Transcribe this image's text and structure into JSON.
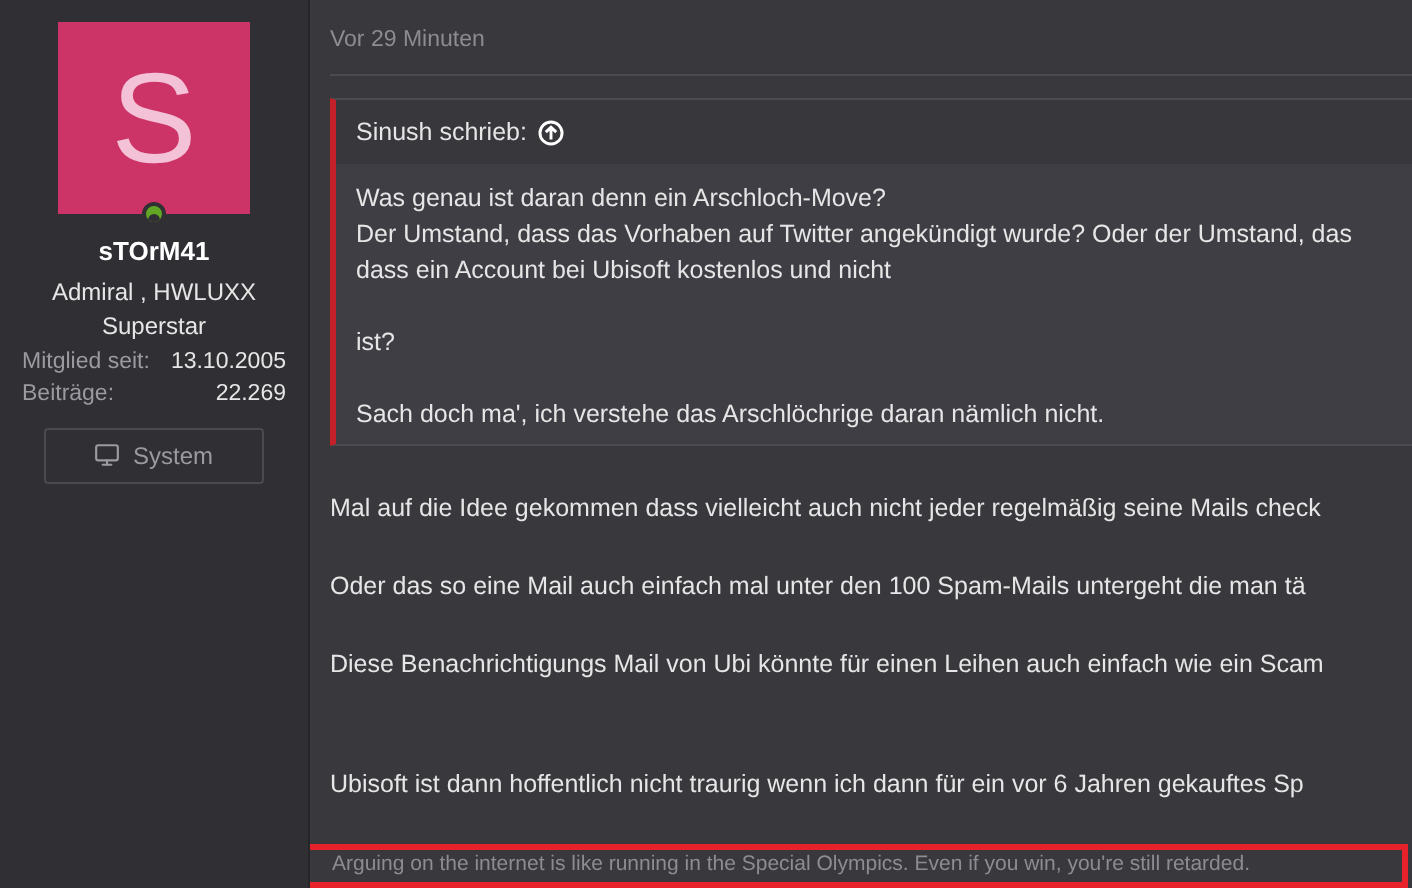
{
  "author": {
    "avatar_letter": "S",
    "online": true,
    "name": "sTOrM41",
    "rank": "Admiral , HWLUXX Superstar",
    "stats": [
      {
        "label": "Mitglied seit:",
        "value": "13.10.2005"
      },
      {
        "label": "Beiträge:",
        "value": "22.269"
      }
    ],
    "system_button": "System"
  },
  "post": {
    "time": "Vor 29 Minuten",
    "quote": {
      "author": "Sinush schrieb:",
      "paragraphs": [
        [
          "Was genau ist daran denn ein Arschloch-Move?",
          "Der Umstand, dass das Vorhaben auf Twitter angekündigt wurde? Oder der Umstand, das",
          "dass ein Account bei Ubisoft kostenlos und nicht"
        ],
        [
          "ist?"
        ],
        [
          "Sach doch ma', ich verstehe das Arschlöchrige daran nämlich nicht."
        ]
      ]
    },
    "sections": [
      [
        "Mal auf die Idee gekommen dass vielleicht auch nicht jeder regelmäßig seine Mails check",
        "Oder das so eine Mail auch einfach mal unter den 100 Spam-Mails untergeht die man tä",
        "Diese Benachrichtigungs Mail von Ubi könnte für einen Leihen auch einfach wie ein Scam"
      ],
      [
        "Ubisoft ist dann hoffentlich nicht traurig wenn ich dann für ein vor 6 Jahren gekauftes Sp"
      ]
    ],
    "signature": "Arguing on the internet is like running in the Special Olympics. Even if you win, you're still retarded.",
    "signature_highlighted": true
  }
}
